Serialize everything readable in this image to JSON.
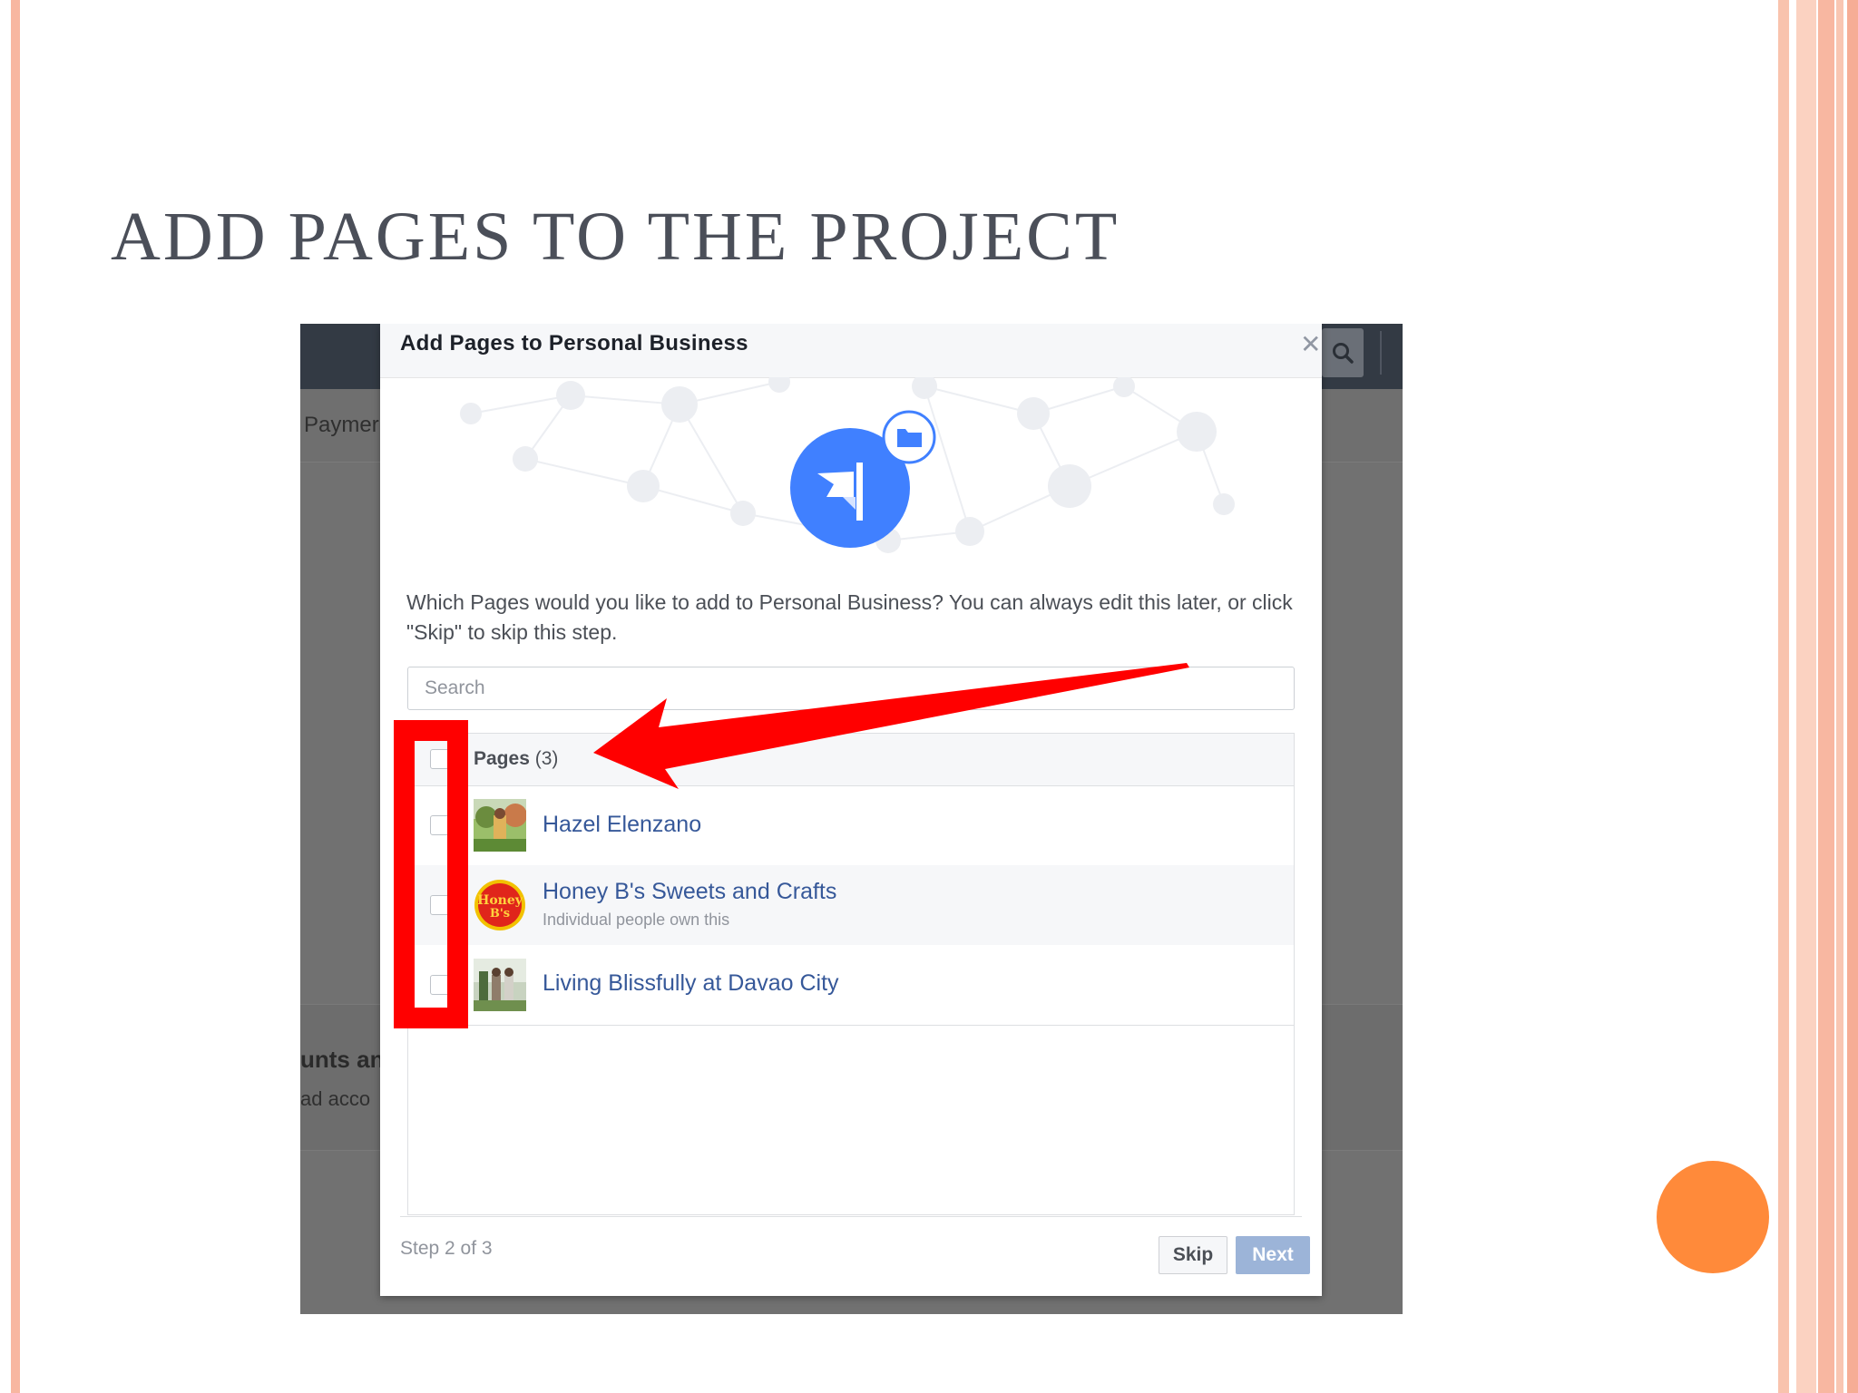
{
  "slide": {
    "title": "ADD PAGES TO THE PROJECT"
  },
  "background_app": {
    "tab_text": "Paymer",
    "section_heading": "unts an",
    "section_sub": "ad acco"
  },
  "dialog": {
    "title": "Add Pages to Personal Business",
    "close_icon": "close-icon",
    "hero_icon": "flag-icon",
    "hero_badge_icon": "folder-icon",
    "prompt": "Which Pages would you like to add to Personal Business? You can always edit this later, or click \"Skip\" to skip this step.",
    "search": {
      "placeholder": "Search",
      "value": ""
    },
    "list": {
      "header_label": "Pages",
      "header_count": "(3)",
      "select_all_checked": false,
      "pages": [
        {
          "name": "Hazel Elenzano",
          "subtitle": "",
          "checked": false
        },
        {
          "name": "Honey B's Sweets and Crafts",
          "subtitle": "Individual people own this",
          "checked": false
        },
        {
          "name": "Living Blissfully at Davao City",
          "subtitle": "",
          "checked": false
        }
      ]
    },
    "step_text": "Step 2 of 3",
    "skip_label": "Skip",
    "next_label": "Next"
  },
  "colors": {
    "link_blue": "#365899",
    "primary_disabled": "#9cb4d8",
    "hero_blue": "#4080ff",
    "annotation_red": "#ff0000",
    "accent_orange": "#ff8a3a",
    "border_peach": "#f8b7a1"
  }
}
